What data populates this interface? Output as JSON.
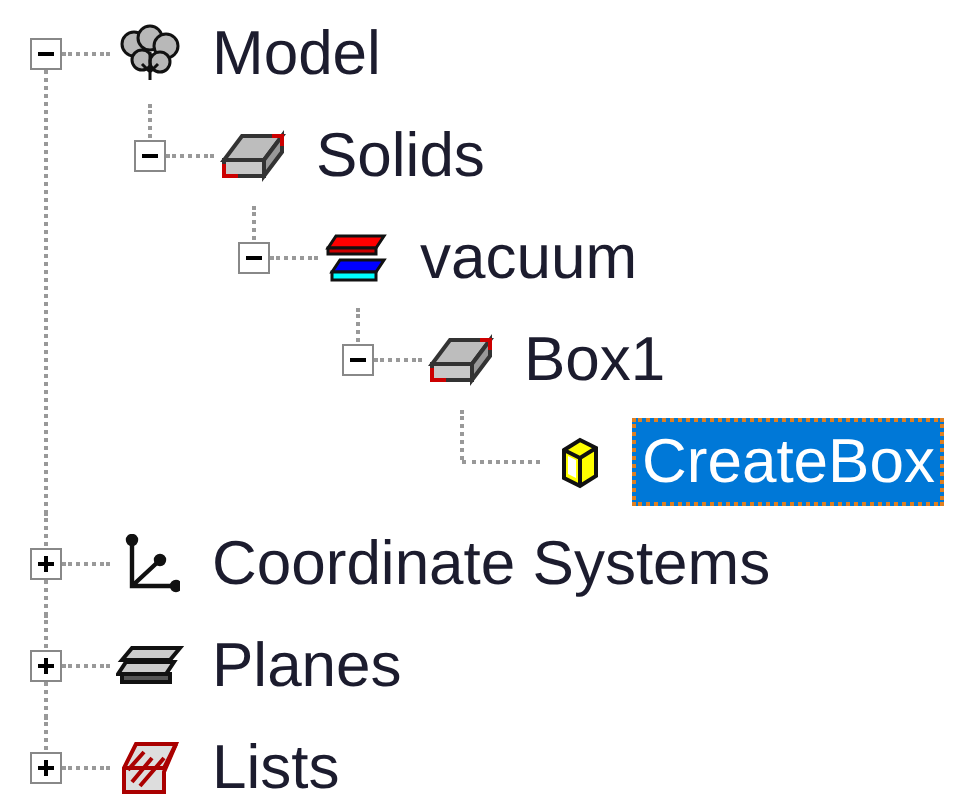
{
  "tree": [
    {
      "label": "Model",
      "kind": "model",
      "expanded": true,
      "selected": false,
      "children": [
        {
          "label": "Solids",
          "kind": "solids",
          "expanded": true,
          "selected": false,
          "children": [
            {
              "label": "vacuum",
              "kind": "material",
              "expanded": true,
              "selected": false,
              "children": [
                {
                  "label": "Box1",
                  "kind": "solid",
                  "expanded": true,
                  "selected": false,
                  "children": [
                    {
                      "label": "CreateBox",
                      "kind": "operation",
                      "selected": true
                    }
                  ]
                }
              ]
            }
          ]
        }
      ]
    },
    {
      "label": "Coordinate Systems",
      "kind": "coordinate-systems",
      "expanded": false,
      "selected": false
    },
    {
      "label": "Planes",
      "kind": "planes",
      "expanded": false,
      "selected": false
    },
    {
      "label": "Lists",
      "kind": "lists",
      "expanded": false,
      "selected": false
    }
  ]
}
